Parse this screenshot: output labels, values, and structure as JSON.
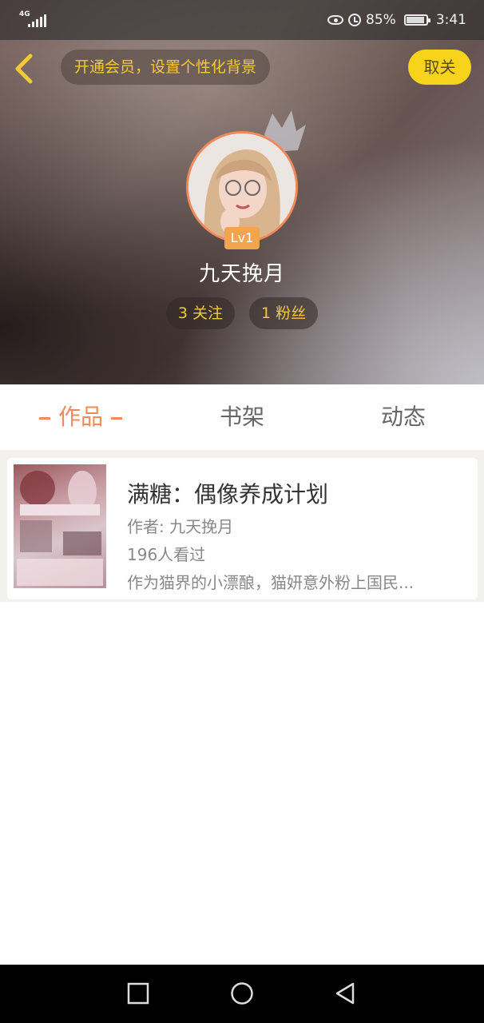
{
  "status_bar": {
    "network": "4G",
    "battery": "85%",
    "time": "3:41",
    "icons": [
      "signal-icon",
      "eye-icon",
      "alarm-icon",
      "battery-icon"
    ]
  },
  "header": {
    "back_icon": "chevron-left-icon",
    "vip_banner": "开通会员，设置个性化背景",
    "close_label": "取关"
  },
  "profile": {
    "level": "Lv1",
    "username": "九天挽月",
    "following_count": "3",
    "following_label": "关注",
    "fans_count": "1",
    "fans_label": "粉丝"
  },
  "tabs": [
    {
      "label": "作品",
      "active": true
    },
    {
      "label": "书架",
      "active": false
    },
    {
      "label": "动态",
      "active": false
    }
  ],
  "works": [
    {
      "title": "满糖：偶像养成计划",
      "author": "作者: 九天挽月",
      "views": "196人看过",
      "description": "作为猫界的小漂酿，猫妍意外粉上国民..."
    }
  ],
  "nav": {
    "icons": [
      "recent-apps-icon",
      "home-icon",
      "back-triangle-icon"
    ]
  },
  "colors": {
    "accent": "#f08a5a",
    "yellow": "#f7d31c",
    "gold_text": "#f3c93a"
  }
}
